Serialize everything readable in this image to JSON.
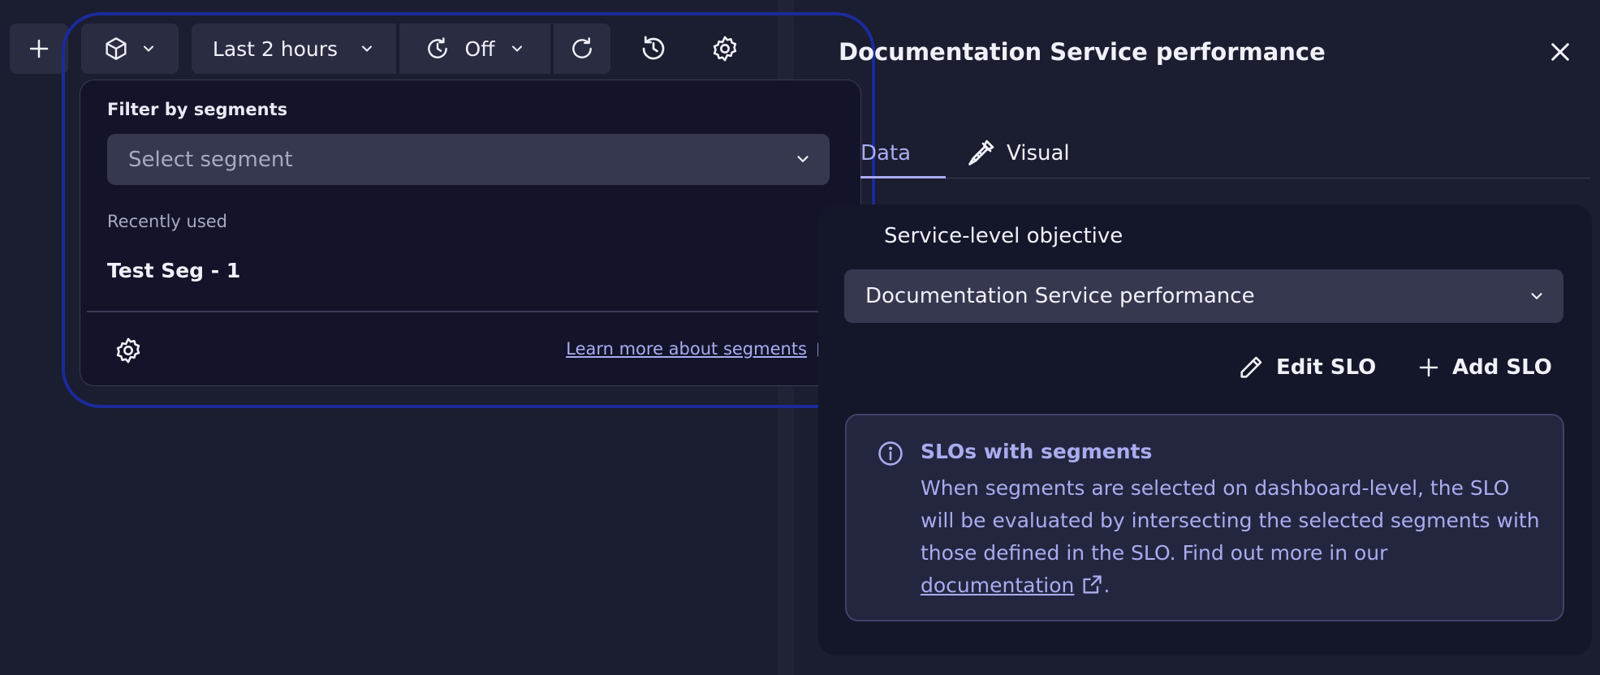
{
  "toolbar": {
    "time_range_label": "Last 2 hours",
    "refresh_label": "Off"
  },
  "segments_popover": {
    "heading": "Filter by segments",
    "select_placeholder": "Select segment",
    "recently_used_label": "Recently used",
    "recent_items": [
      "Test Seg - 1"
    ],
    "learn_more_label": "Learn more about segments"
  },
  "panel": {
    "title": "Documentation Service performance",
    "tabs": [
      {
        "label": "Data",
        "active": true
      },
      {
        "label": "Visual",
        "active": false
      }
    ],
    "slo_section_label": "Service-level objective",
    "slo_selected_value": "Documentation Service performance",
    "edit_slo_label": "Edit SLO",
    "add_slo_label": "Add SLO",
    "info": {
      "title": "SLOs with segments",
      "body": "When segments are selected on dashboard-level, the SLO will be evaluated by intersecting the selected segments with those defined in the SLO. Find out more in our",
      "link_text": "documentation",
      "trailing": "."
    }
  },
  "icons": {
    "add": "plus-icon",
    "segments": "cube-icon",
    "refresh_interval": "clock-refresh-icon",
    "refresh": "refresh-icon",
    "history": "history-icon",
    "settings": "gear-icon",
    "external": "external-link-icon",
    "close": "close-icon",
    "visual": "brush-icon",
    "edit": "pencil-icon",
    "info": "info-icon"
  },
  "colors": {
    "background": "#1b1d30",
    "accent": "#a9acef",
    "focus_ring": "#1b2a9a",
    "input": "#363850"
  }
}
